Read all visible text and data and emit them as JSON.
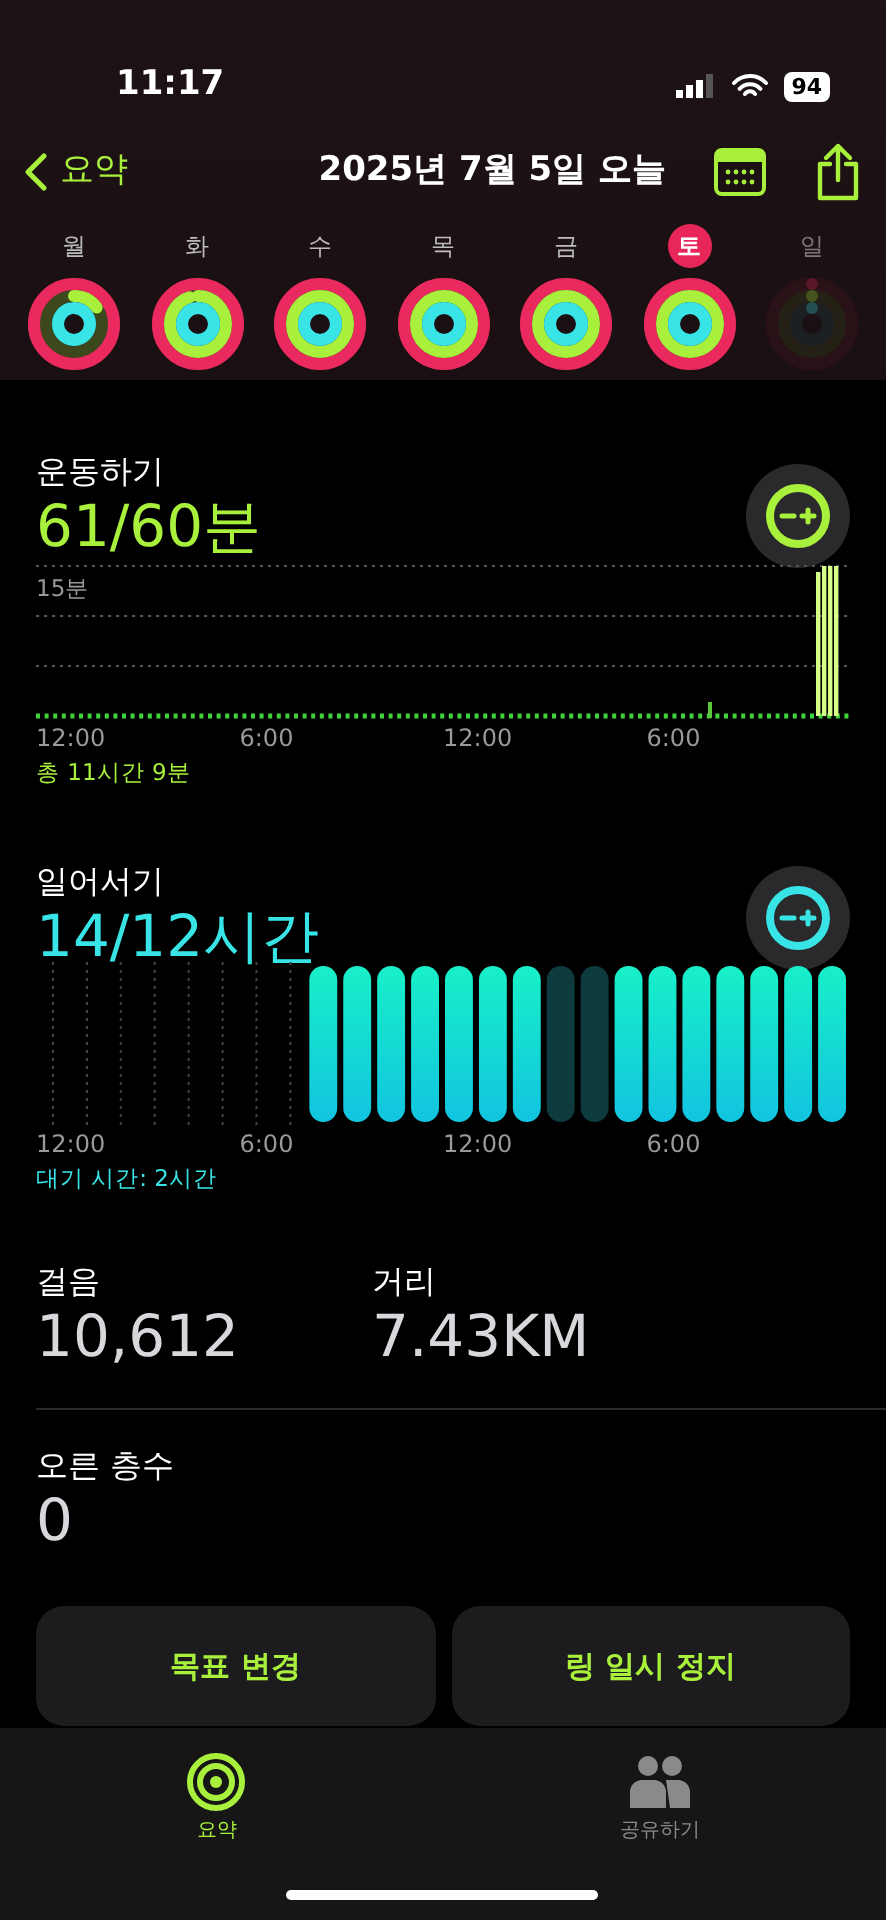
{
  "status_bar": {
    "time": "11:17",
    "battery": "94"
  },
  "nav": {
    "back": "요약",
    "title": "2025년 7월 5일 오늘"
  },
  "days": [
    {
      "label": "월",
      "selected": false,
      "disabled": false
    },
    {
      "label": "화",
      "selected": false,
      "disabled": false
    },
    {
      "label": "수",
      "selected": false,
      "disabled": false
    },
    {
      "label": "목",
      "selected": false,
      "disabled": false
    },
    {
      "label": "금",
      "selected": false,
      "disabled": false
    },
    {
      "label": "토",
      "selected": true,
      "disabled": false
    },
    {
      "label": "일",
      "selected": false,
      "disabled": true
    }
  ],
  "exercise": {
    "label": "운동하기",
    "value": "61/60분",
    "y_tick": "15분",
    "x_ticks": [
      "12:00",
      "6:00",
      "12:00",
      "6:00"
    ],
    "total": "총 11시간 9분"
  },
  "stand": {
    "label": "일어서기",
    "value": "14/12시간",
    "x_ticks": [
      "12:00",
      "6:00",
      "12:00",
      "6:00"
    ],
    "footer": "대기 시간: 2시간",
    "hours": [
      {
        "stood": true
      },
      {
        "stood": true
      },
      {
        "stood": true
      },
      {
        "stood": true
      },
      {
        "stood": true
      },
      {
        "stood": true
      },
      {
        "stood": true
      },
      {
        "stood": false
      },
      {
        "stood": false
      },
      {
        "stood": true
      },
      {
        "stood": true
      },
      {
        "stood": true
      },
      {
        "stood": true
      },
      {
        "stood": true
      },
      {
        "stood": true
      },
      {
        "stood": true
      }
    ]
  },
  "stats": [
    {
      "label": "걸음",
      "value": "10,612"
    },
    {
      "label": "거리",
      "value": "7.43KM"
    }
  ],
  "floors": {
    "label": "오른 층수",
    "value": "0"
  },
  "buttons": [
    "목표 변경",
    "링 일시 정지"
  ],
  "tabs": [
    {
      "label": "요약",
      "selected": true
    },
    {
      "label": "공유하기",
      "selected": false
    }
  ]
}
